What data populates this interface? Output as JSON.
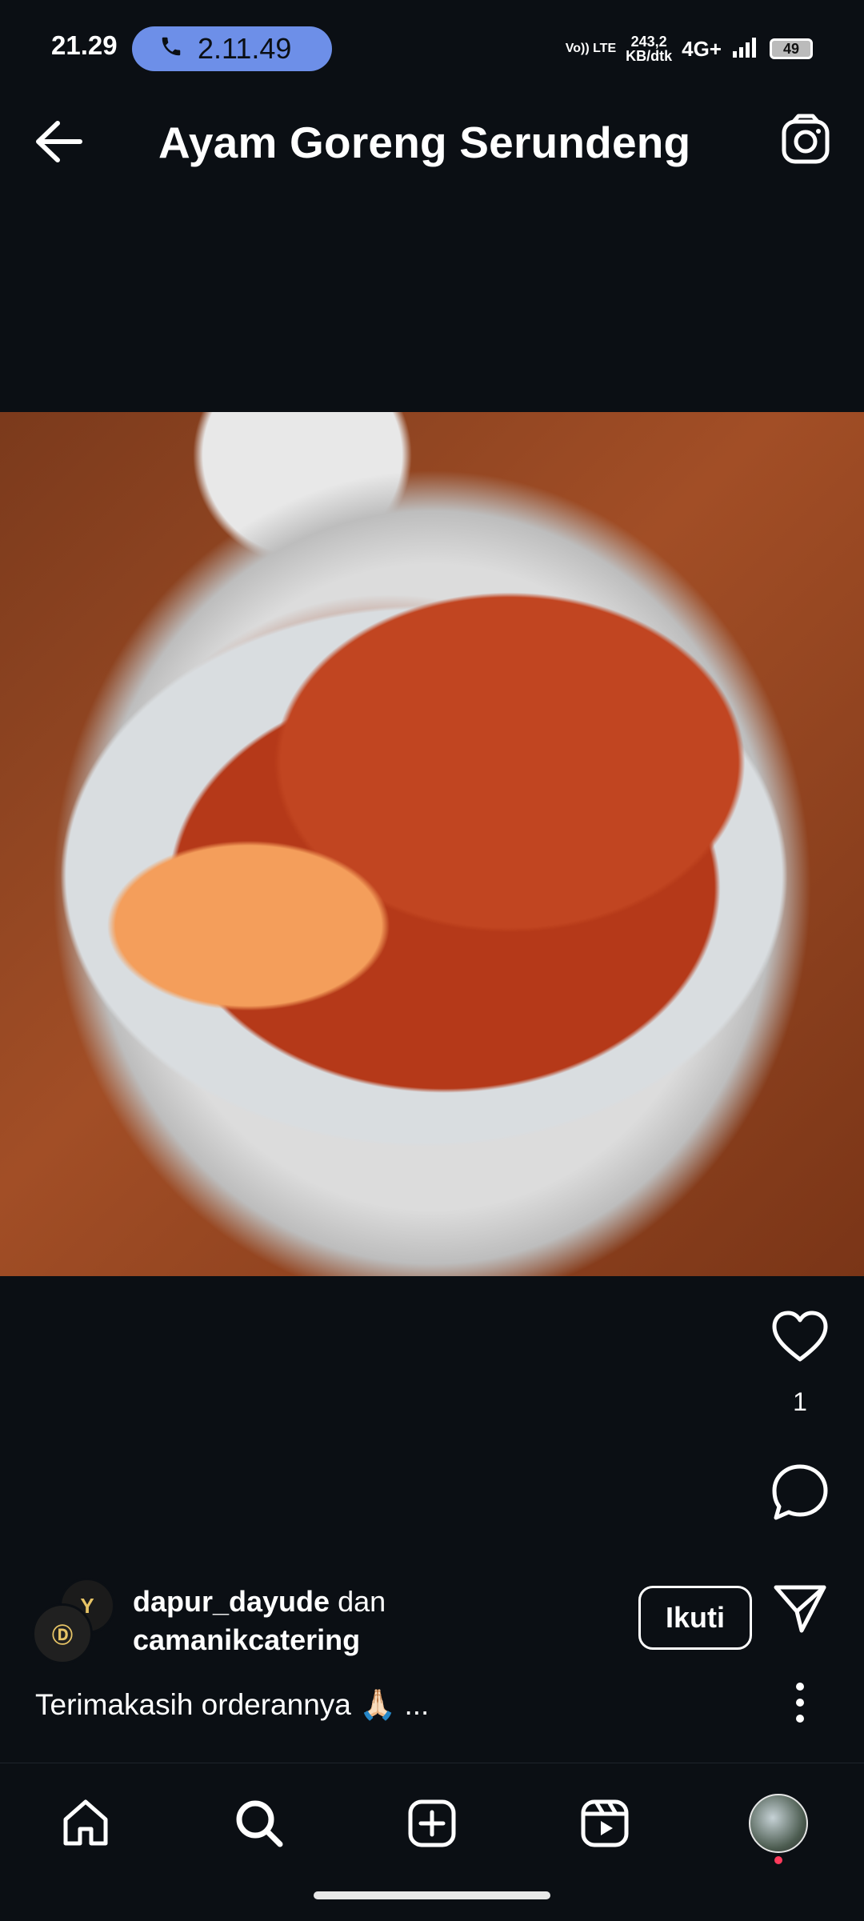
{
  "status": {
    "time": "21.29",
    "call_timer": "2.11.49",
    "volte": "Vo)) LTE",
    "speed_top": "243,2",
    "speed_bottom": "KB/dtk",
    "network": "4G+",
    "battery": "49"
  },
  "header": {
    "title": "Ayam Goreng Serundeng"
  },
  "post": {
    "like_count": "1",
    "author_primary": "dapur_dayude",
    "author_join": " dan",
    "author_secondary": "camanikcatering",
    "follow_label": "Ikuti",
    "caption": "Terimakasih orderannya 🙏🏻 ..."
  },
  "icons": {
    "back": "back-arrow-icon",
    "camera": "camera-icon",
    "like": "heart-icon",
    "comment": "comment-icon",
    "share": "send-icon",
    "more": "more-vertical-icon"
  }
}
